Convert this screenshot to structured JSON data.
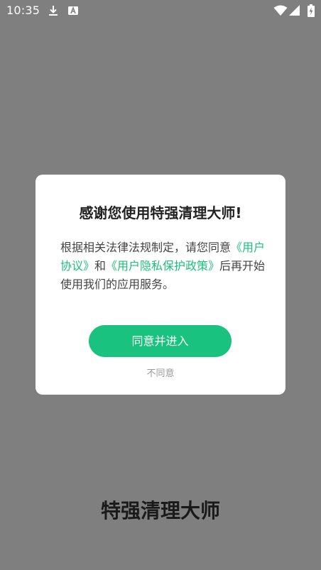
{
  "status_bar": {
    "time": "10:35",
    "icons": [
      "download-icon",
      "a-notification-icon",
      "wifi-icon",
      "signal-icon",
      "battery-charging-icon"
    ]
  },
  "dialog": {
    "title": "感谢您使用特强清理大师!",
    "body_text_1": "根据相关法律法规制定，请您同意",
    "link_user_agreement": "《用户协议》",
    "body_and": "和",
    "link_privacy_policy": "《用户隐私保护政策》",
    "body_text_2": "后再开始使用我们的应用服务。",
    "agree_button": "同意并进入",
    "disagree_link": "不同意"
  },
  "app": {
    "name": "特强清理大师"
  },
  "colors": {
    "overlay": "#7f7f7f",
    "accent": "#19c27e",
    "link": "#1dbf7a"
  }
}
